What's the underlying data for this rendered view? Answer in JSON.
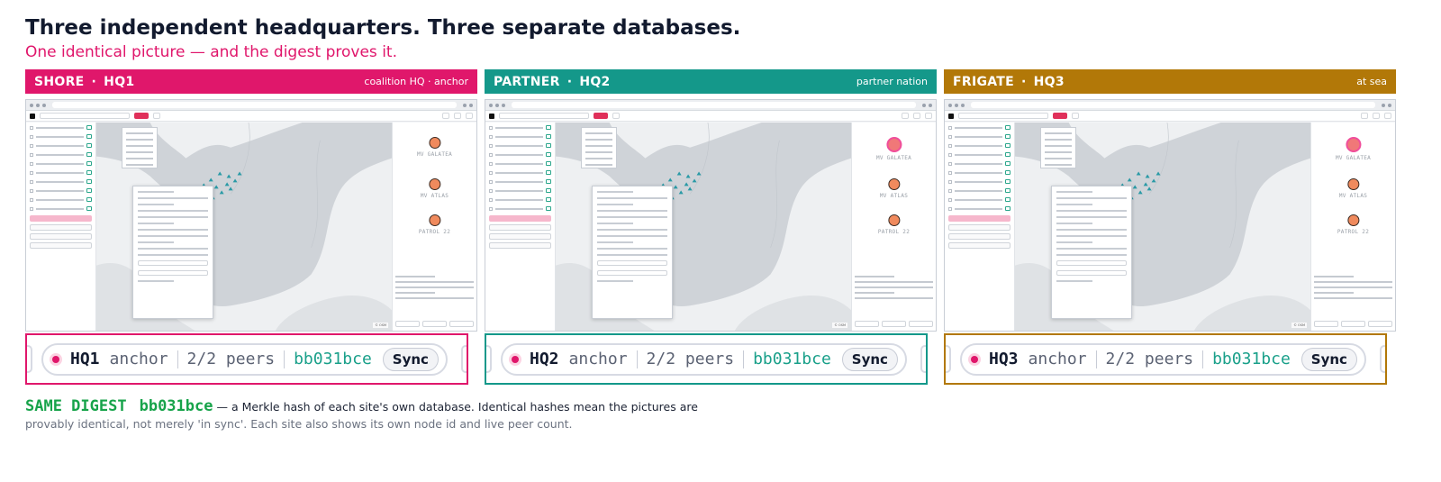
{
  "headline": "Three independent headquarters. Three separate databases.",
  "subheadline": "One identical picture — and the digest proves it.",
  "panels": [
    {
      "site": "SHORE",
      "hq": "HQ1",
      "descriptor": "coalition HQ · anchor",
      "color": "#e0176b",
      "status": {
        "node": "HQ1",
        "role": "anchor",
        "peers": "2/2 peers",
        "digest": "bb031bce",
        "sync_label": "Sync"
      }
    },
    {
      "site": "PARTNER",
      "hq": "HQ2",
      "descriptor": "partner nation",
      "color": "#14988a",
      "status": {
        "node": "HQ2",
        "role": "anchor",
        "peers": "2/2 peers",
        "digest": "bb031bce",
        "sync_label": "Sync"
      }
    },
    {
      "site": "FRIGATE",
      "hq": "HQ3",
      "descriptor": "at sea",
      "color": "#b27808",
      "status": {
        "node": "HQ3",
        "role": "anchor",
        "peers": "2/2 peers",
        "digest": "bb031bce",
        "sync_label": "Sync"
      }
    }
  ],
  "separator": "·",
  "ships": [
    "MV GALATEA",
    "MV ATLAS",
    "PATROL 22"
  ],
  "footer": {
    "same_label": "SAME DIGEST",
    "digest": "bb031bce",
    "line1": "— a Merkle hash of each site's own database. Identical hashes mean the pictures are",
    "line2": "provably identical, not merely 'in sync'. Each site also shows its own node id and live peer count."
  }
}
